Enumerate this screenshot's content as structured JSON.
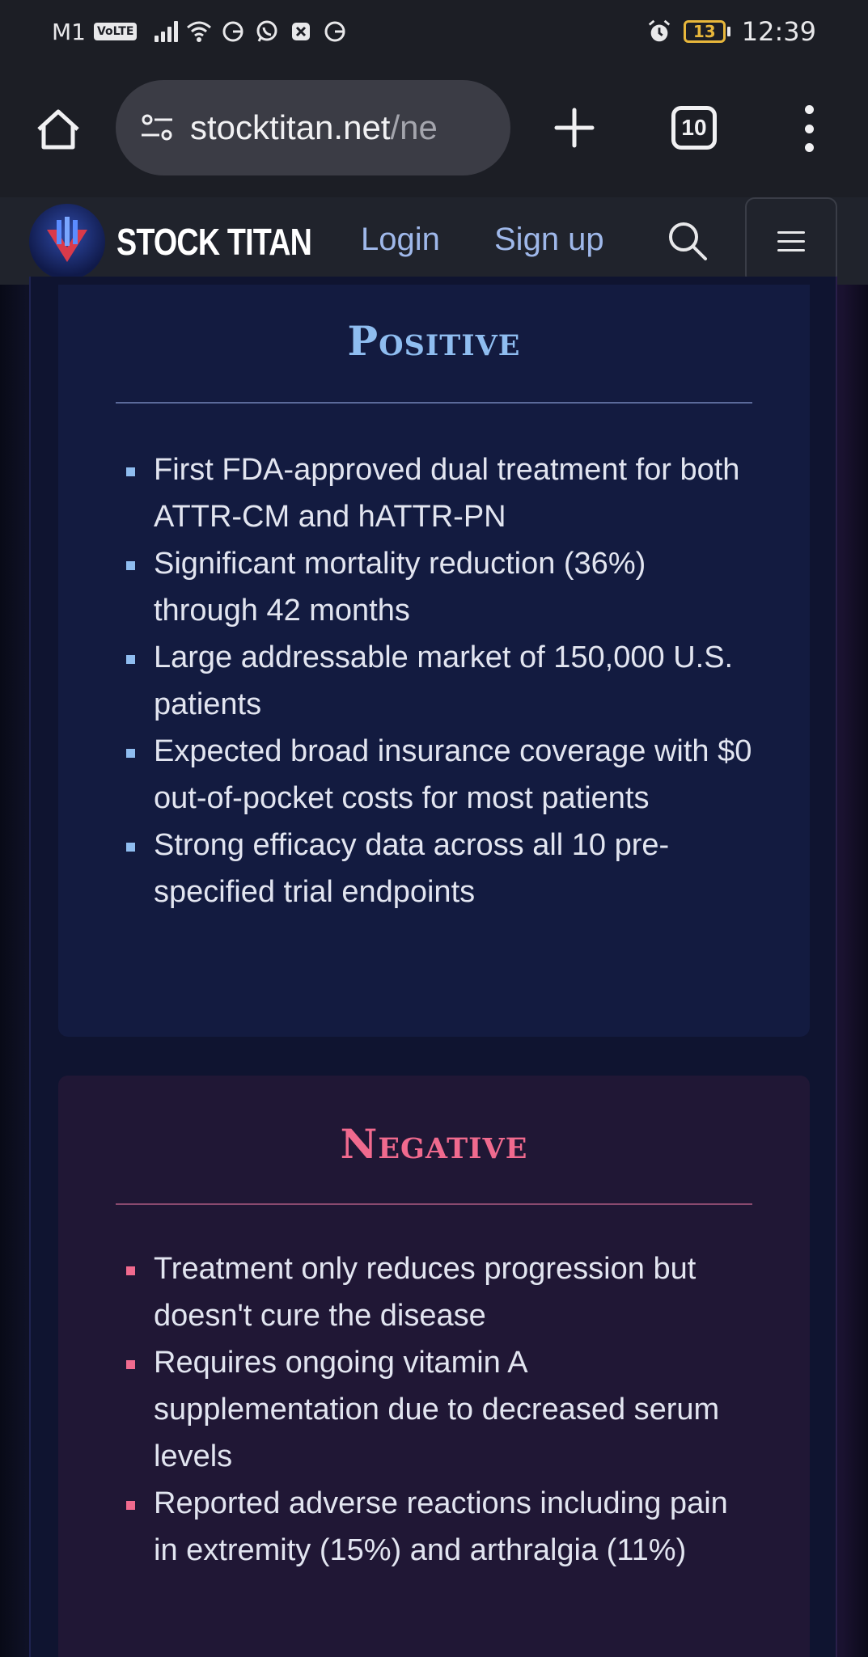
{
  "status_bar": {
    "carrier": "M1",
    "volte": "VoLTE",
    "battery_level": "13",
    "time": "12:39",
    "icons": [
      "signal-icon",
      "wifi-icon",
      "g-icon",
      "whatsapp-icon",
      "close-box-icon",
      "g-icon",
      "alarm-icon",
      "battery-icon"
    ]
  },
  "browser": {
    "url_main": "stocktitan.net",
    "url_rest": "/ne",
    "tab_count": "10"
  },
  "site_header": {
    "brand": "STOCK TITAN",
    "login": "Login",
    "signup": "Sign up"
  },
  "positive": {
    "title": "Positive",
    "items": [
      "First FDA-approved dual treatment for both ATTR-CM and hATTR-PN",
      "Significant mortality reduction (36%) through 42 months",
      "Large addressable market of 150,000 U.S. patients",
      "Expected broad insurance coverage with $0 out-of-pocket costs for most patients",
      "Strong efficacy data across all 10 pre-specified trial endpoints"
    ]
  },
  "negative": {
    "title": "Negative",
    "items": [
      "Treatment only reduces progression but doesn't cure the disease",
      "Requires ongoing vitamin A supplementation due to decreased serum levels",
      "Reported adverse reactions including pain in extremity (15%) and arthralgia (11%)"
    ]
  },
  "colors": {
    "positive_accent": "#8fbdf0",
    "negative_accent": "#f06a8e",
    "nav_link": "#9fb8ea"
  }
}
